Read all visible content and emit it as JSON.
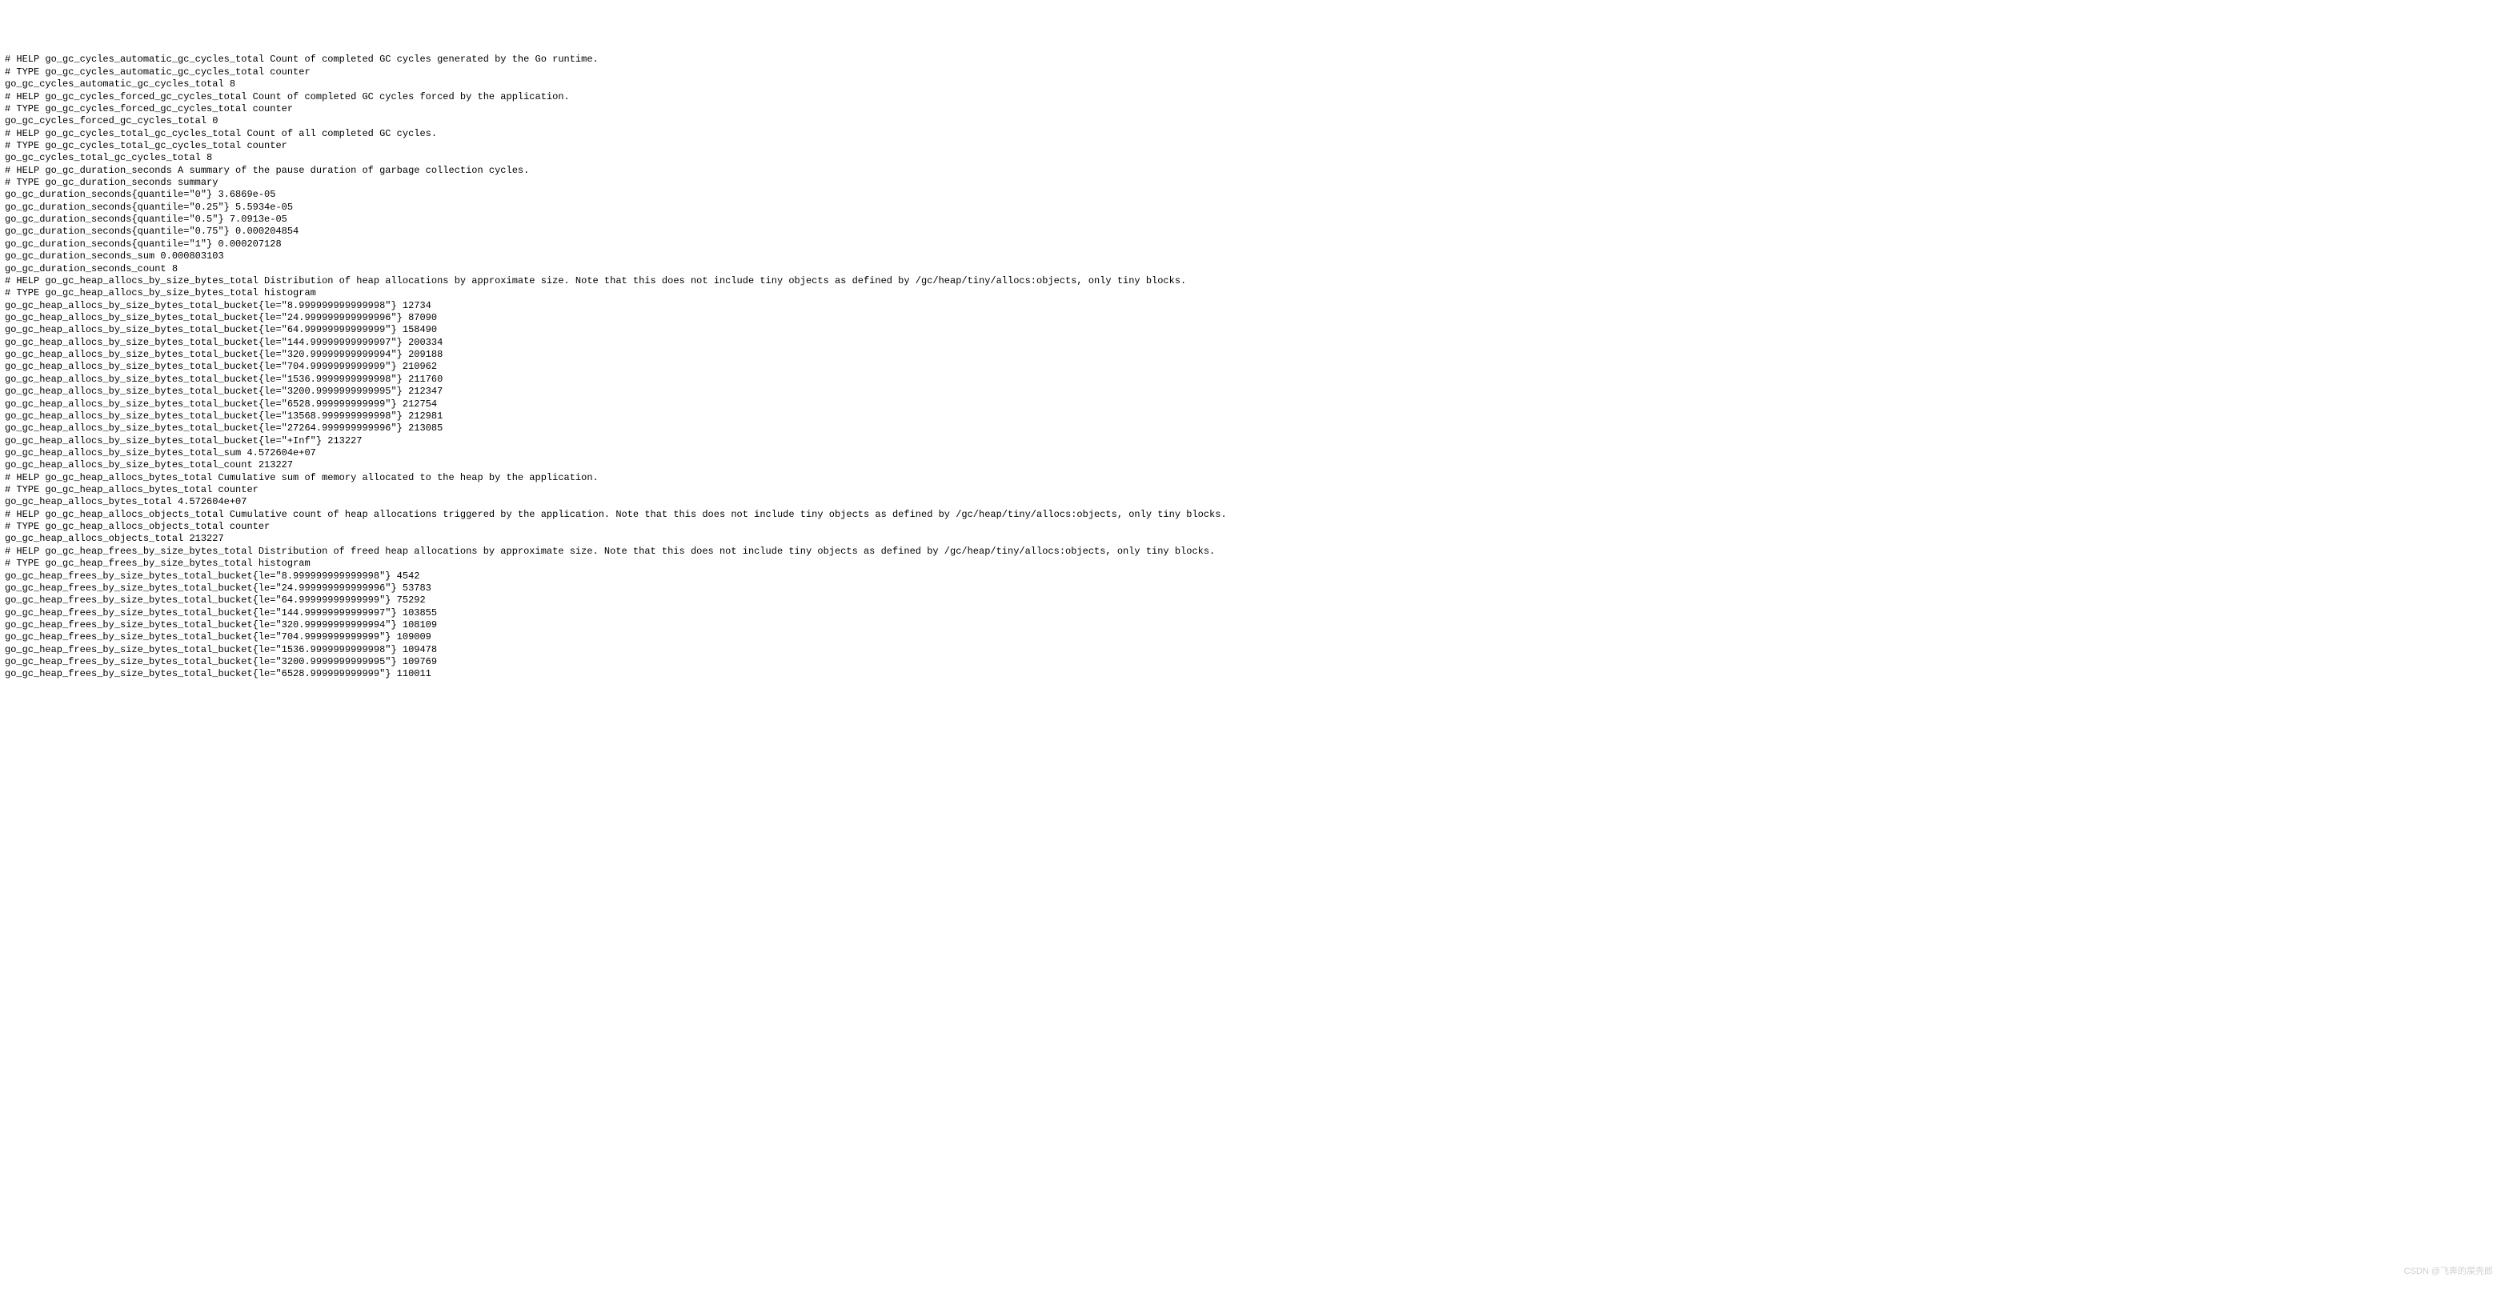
{
  "lines": [
    "# HELP go_gc_cycles_automatic_gc_cycles_total Count of completed GC cycles generated by the Go runtime.",
    "# TYPE go_gc_cycles_automatic_gc_cycles_total counter",
    "go_gc_cycles_automatic_gc_cycles_total 8",
    "# HELP go_gc_cycles_forced_gc_cycles_total Count of completed GC cycles forced by the application.",
    "# TYPE go_gc_cycles_forced_gc_cycles_total counter",
    "go_gc_cycles_forced_gc_cycles_total 0",
    "# HELP go_gc_cycles_total_gc_cycles_total Count of all completed GC cycles.",
    "# TYPE go_gc_cycles_total_gc_cycles_total counter",
    "go_gc_cycles_total_gc_cycles_total 8",
    "# HELP go_gc_duration_seconds A summary of the pause duration of garbage collection cycles.",
    "# TYPE go_gc_duration_seconds summary",
    "go_gc_duration_seconds{quantile=\"0\"} 3.6869e-05",
    "go_gc_duration_seconds{quantile=\"0.25\"} 5.5934e-05",
    "go_gc_duration_seconds{quantile=\"0.5\"} 7.0913e-05",
    "go_gc_duration_seconds{quantile=\"0.75\"} 0.000204854",
    "go_gc_duration_seconds{quantile=\"1\"} 0.000207128",
    "go_gc_duration_seconds_sum 0.000803103",
    "go_gc_duration_seconds_count 8",
    "# HELP go_gc_heap_allocs_by_size_bytes_total Distribution of heap allocations by approximate size. Note that this does not include tiny objects as defined by /gc/heap/tiny/allocs:objects, only tiny blocks.",
    "# TYPE go_gc_heap_allocs_by_size_bytes_total histogram",
    "go_gc_heap_allocs_by_size_bytes_total_bucket{le=\"8.999999999999998\"} 12734",
    "go_gc_heap_allocs_by_size_bytes_total_bucket{le=\"24.999999999999996\"} 87090",
    "go_gc_heap_allocs_by_size_bytes_total_bucket{le=\"64.99999999999999\"} 158490",
    "go_gc_heap_allocs_by_size_bytes_total_bucket{le=\"144.99999999999997\"} 200334",
    "go_gc_heap_allocs_by_size_bytes_total_bucket{le=\"320.99999999999994\"} 209188",
    "go_gc_heap_allocs_by_size_bytes_total_bucket{le=\"704.9999999999999\"} 210962",
    "go_gc_heap_allocs_by_size_bytes_total_bucket{le=\"1536.9999999999998\"} 211760",
    "go_gc_heap_allocs_by_size_bytes_total_bucket{le=\"3200.9999999999995\"} 212347",
    "go_gc_heap_allocs_by_size_bytes_total_bucket{le=\"6528.999999999999\"} 212754",
    "go_gc_heap_allocs_by_size_bytes_total_bucket{le=\"13568.999999999998\"} 212981",
    "go_gc_heap_allocs_by_size_bytes_total_bucket{le=\"27264.999999999996\"} 213085",
    "go_gc_heap_allocs_by_size_bytes_total_bucket{le=\"+Inf\"} 213227",
    "go_gc_heap_allocs_by_size_bytes_total_sum 4.572604e+07",
    "go_gc_heap_allocs_by_size_bytes_total_count 213227",
    "# HELP go_gc_heap_allocs_bytes_total Cumulative sum of memory allocated to the heap by the application.",
    "# TYPE go_gc_heap_allocs_bytes_total counter",
    "go_gc_heap_allocs_bytes_total 4.572604e+07",
    "# HELP go_gc_heap_allocs_objects_total Cumulative count of heap allocations triggered by the application. Note that this does not include tiny objects as defined by /gc/heap/tiny/allocs:objects, only tiny blocks.",
    "# TYPE go_gc_heap_allocs_objects_total counter",
    "go_gc_heap_allocs_objects_total 213227",
    "# HELP go_gc_heap_frees_by_size_bytes_total Distribution of freed heap allocations by approximate size. Note that this does not include tiny objects as defined by /gc/heap/tiny/allocs:objects, only tiny blocks.",
    "# TYPE go_gc_heap_frees_by_size_bytes_total histogram",
    "go_gc_heap_frees_by_size_bytes_total_bucket{le=\"8.999999999999998\"} 4542",
    "go_gc_heap_frees_by_size_bytes_total_bucket{le=\"24.999999999999996\"} 53783",
    "go_gc_heap_frees_by_size_bytes_total_bucket{le=\"64.99999999999999\"} 75292",
    "go_gc_heap_frees_by_size_bytes_total_bucket{le=\"144.99999999999997\"} 103855",
    "go_gc_heap_frees_by_size_bytes_total_bucket{le=\"320.99999999999994\"} 108109",
    "go_gc_heap_frees_by_size_bytes_total_bucket{le=\"704.9999999999999\"} 109009",
    "go_gc_heap_frees_by_size_bytes_total_bucket{le=\"1536.9999999999998\"} 109478",
    "go_gc_heap_frees_by_size_bytes_total_bucket{le=\"3200.9999999999995\"} 109769",
    "go_gc_heap_frees_by_size_bytes_total_bucket{le=\"6528.999999999999\"} 110011"
  ],
  "watermark": "CSDN @飞奔的屎壳郎"
}
